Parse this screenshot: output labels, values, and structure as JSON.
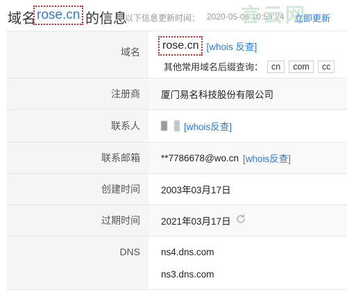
{
  "header": {
    "prefix": "域名",
    "domain": "rose.cn",
    "suffix": "的信息",
    "update_label": "以下信息更新时间：",
    "update_time": "2020-05-06 10:59:24",
    "refresh": "立即更新",
    "watermark": "言云网"
  },
  "rows": {
    "domain": {
      "label": "域名",
      "value": "rose.cn",
      "whois": "[whois 反查]",
      "suffix_label": "其他常用域名后缀查询：",
      "suffixes": [
        "cn",
        "com",
        "cc"
      ]
    },
    "registrar": {
      "label": "注册商",
      "value": "厦门易名科技股份有限公司"
    },
    "contact": {
      "label": "联系人",
      "whois": "[whois反查]"
    },
    "email": {
      "label": "联系邮箱",
      "value": "**7786678@wo.cn",
      "whois": "[whois反查]"
    },
    "created": {
      "label": "创建时间",
      "value": "2003年03月17日"
    },
    "expiry": {
      "label": "过期时间",
      "value": "2021年03月17日"
    },
    "dns": {
      "label": "DNS",
      "values": [
        "ns4.dns.com",
        "ns3.dns.com"
      ]
    }
  },
  "colors": {
    "link": "#2c7be5",
    "highlight_border": "#e02020",
    "label_bg": "#f5f5f5"
  },
  "icons": {
    "refresh": "refresh-icon"
  }
}
